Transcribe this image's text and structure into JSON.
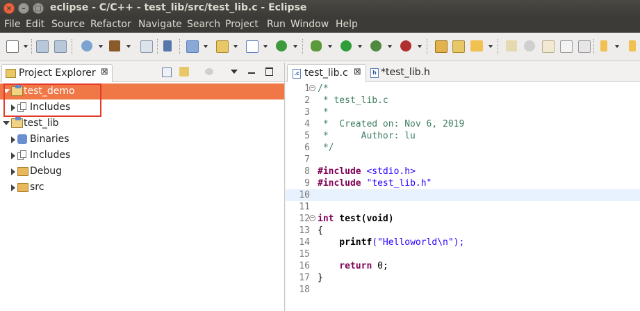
{
  "window": {
    "title": "eclipse - C/C++ - test_lib/src/test_lib.c - Eclipse"
  },
  "menu": [
    "File",
    "Edit",
    "Source",
    "Refactor",
    "Navigate",
    "Search",
    "Project",
    "Run",
    "Window",
    "Help"
  ],
  "explorer": {
    "tab_label": "Project Explorer",
    "close_glyph": "⊠",
    "tree": [
      {
        "label": "test_demo",
        "expanded": true,
        "selected": true
      },
      {
        "label": "Includes"
      },
      {
        "label": "test_lib",
        "expanded": true
      },
      {
        "label": "Binaries"
      },
      {
        "label": "Includes"
      },
      {
        "label": "Debug"
      },
      {
        "label": "src"
      }
    ]
  },
  "editor": {
    "tabs": [
      {
        "label": "test_lib.c",
        "close": "⊠",
        "icon": ".c",
        "active": true
      },
      {
        "label": "*test_lib.h",
        "icon": "h",
        "active": false
      }
    ],
    "lines": [
      {
        "n": "1",
        "text": "/*"
      },
      {
        "n": "2",
        "text": " * test_lib.c"
      },
      {
        "n": "3",
        "text": " *"
      },
      {
        "n": "4",
        "text": " *  Created on: Nov 6, 2019"
      },
      {
        "n": "5",
        "text": " *      Author: lu"
      },
      {
        "n": "6",
        "text": " */"
      },
      {
        "n": "7",
        "text": ""
      },
      {
        "n": "8",
        "text_kw": "#include",
        "text_rest": " <stdio.h>"
      },
      {
        "n": "9",
        "text_kw": "#include",
        "text_rest": " \"test_lib.h\""
      },
      {
        "n": "10",
        "text": ""
      },
      {
        "n": "11",
        "text": ""
      },
      {
        "n": "12",
        "text_kw": "int",
        "text_rest": " test(void)"
      },
      {
        "n": "13",
        "text": "{"
      },
      {
        "n": "14",
        "text_fn": "    printf",
        "text_rest": "(\"Helloworld\\n\");"
      },
      {
        "n": "15",
        "text": ""
      },
      {
        "n": "16",
        "text_kw": "    return",
        "text_rest": " 0;"
      },
      {
        "n": "17",
        "text": "}"
      },
      {
        "n": "18",
        "text": ""
      }
    ]
  },
  "colors": {
    "selection": "#f07746",
    "highlight_box": "#e53a2a",
    "current_line": "#e8f2fe"
  }
}
